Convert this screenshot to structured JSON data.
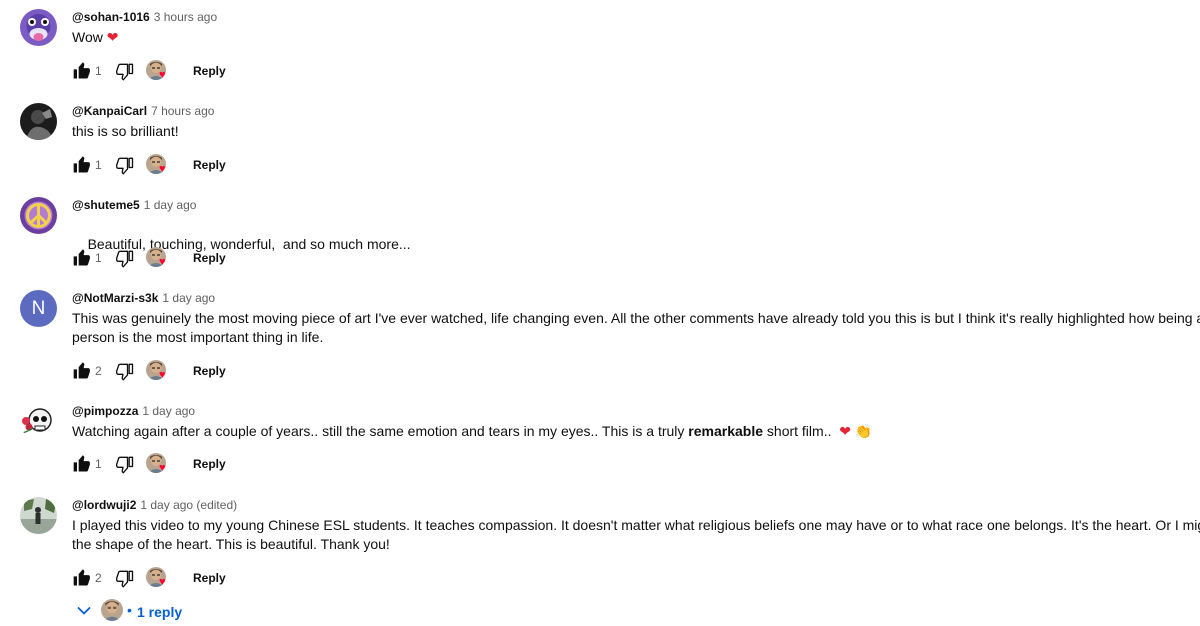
{
  "colors": {
    "reply_link": "#065fd4",
    "secondary_text": "#606060",
    "heart_red": "#ff0033",
    "letter_avatar_bg": "#5c6bc0"
  },
  "comments": [
    {
      "author": "@sohan-1016",
      "time": "3 hours ago",
      "text": "Wow",
      "emoji": "heart",
      "likes": "1",
      "reply_label": "Reply"
    },
    {
      "author": "@KanpaiCarl",
      "time": "7 hours ago",
      "text": "this is so brilliant!",
      "likes": "1",
      "reply_label": "Reply"
    },
    {
      "author": "@shuteme5",
      "time": "1 day ago",
      "text": "Beautiful, touching, wonderful,  and so much more...",
      "likes": "1",
      "reply_label": "Reply"
    },
    {
      "author": "@NotMarzi-s3k",
      "time": "1 day ago",
      "avatar_letter": "N",
      "text_line1": "This was genuinely the most moving piece of art I've ever watched, life changing even. All the other comments have already told you this is but I think it's really highlighted how being a kind",
      "text_line2": "person is the most important thing in life.",
      "likes": "2",
      "reply_label": "Reply"
    },
    {
      "author": "@pimpozza",
      "time": "1 day ago",
      "text_before": "Watching again after a couple of years.. still the same emotion and tears in my eyes.. This is a truly ",
      "text_bold": "remarkable",
      "text_after": " short film..",
      "emojis": [
        "heart",
        "clapping-hands"
      ],
      "likes": "1",
      "reply_label": "Reply"
    },
    {
      "author": "@lordwuji2",
      "time": "1 day ago (edited)",
      "text_line1": "I played this video to my young Chinese ESL students. It teaches compassion. It doesn't matter what religious beliefs one may have or to what race one belongs. It's the heart. Or I might say, it's",
      "text_line2": "the shape of the heart. This is beautiful. Thank you!",
      "likes": "2",
      "reply_label": "Reply"
    }
  ],
  "replies_toggle": {
    "separator": "•",
    "label": "1 reply"
  }
}
